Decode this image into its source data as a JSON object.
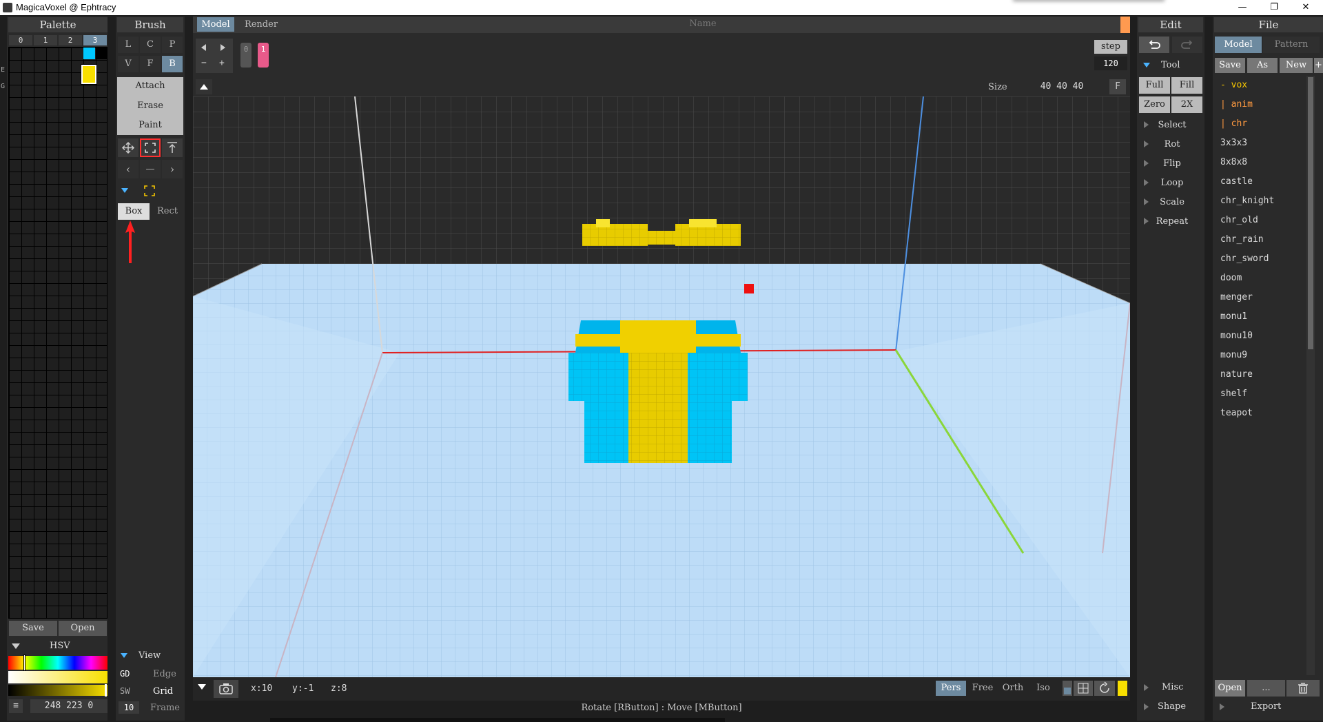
{
  "window": {
    "title": "MagicaVoxel @ Ephtracy",
    "min": "—",
    "max": "❐",
    "close": "✕"
  },
  "palette": {
    "title": "Palette",
    "tabs": [
      "0",
      "1",
      "2",
      "3"
    ],
    "side_labels": [
      "E",
      "G"
    ],
    "save": "Save",
    "open": "Open",
    "hsv_label": "HSV",
    "menu_icon": "≡",
    "color_value": "248 223 0",
    "colors": {
      "cyan": "#00c8ff",
      "yellow": "#f8df00"
    }
  },
  "brush": {
    "title": "Brush",
    "row1": [
      "L",
      "C",
      "P"
    ],
    "row2": [
      "V",
      "F",
      "B"
    ],
    "modes": [
      "Attach",
      "Erase",
      "Paint"
    ],
    "shape_box": "Box",
    "shape_rect": "Rect",
    "view_label": "View",
    "view_rows": [
      {
        "a": "GD",
        "b": "Edge"
      },
      {
        "a": "SW",
        "b": "Grid"
      },
      {
        "a": "10",
        "b": "Frame"
      }
    ]
  },
  "viewport": {
    "tab_model": "Model",
    "tab_render": "Render",
    "name_placeholder": "Name",
    "frame_0": "0",
    "frame_1": "1",
    "step_label": "step",
    "step_value": "120",
    "size_label": "Size",
    "size_value": "40 40 40",
    "size_f": "F",
    "coords": {
      "x": "x:10",
      "y": "y:-1",
      "z": "z:8"
    },
    "projections": [
      "Pers",
      "Free",
      "Orth",
      "Iso"
    ],
    "status": "Rotate [RButton] : Move [MButton]"
  },
  "edit": {
    "title": "Edit",
    "tool_label": "Tool",
    "tool_buttons": [
      "Full",
      "Fill",
      "Zero",
      "2X"
    ],
    "sections": [
      "Select",
      "Rot",
      "Flip",
      "Loop",
      "Scale",
      "Repeat"
    ],
    "misc": "Misc",
    "shape": "Shape"
  },
  "file": {
    "title": "File",
    "tab_model": "Model",
    "tab_pattern": "Pattern",
    "save": "Save",
    "as": "As",
    "new": "New",
    "plus": "+",
    "folder": "- vox",
    "subfolders": [
      "| anim",
      "| chr"
    ],
    "files": [
      "3x3x3",
      "8x8x8",
      "castle",
      "chr_knight",
      "chr_old",
      "chr_rain",
      "chr_sword",
      "doom",
      "menger",
      "monu1",
      "monu10",
      "monu9",
      "nature",
      "shelf",
      "teapot"
    ],
    "open": "Open",
    "more": "...",
    "export": "Export"
  }
}
